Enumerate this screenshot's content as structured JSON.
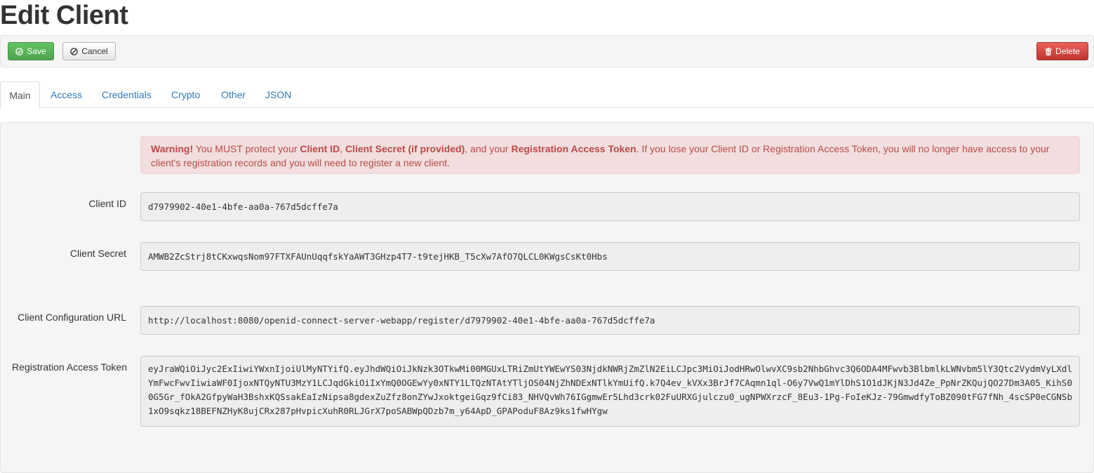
{
  "page": {
    "title": "Edit Client"
  },
  "toolbar": {
    "save_label": "Save",
    "cancel_label": "Cancel",
    "delete_label": "Delete"
  },
  "tabs": [
    {
      "label": "Main",
      "active": true
    },
    {
      "label": "Access",
      "active": false
    },
    {
      "label": "Credentials",
      "active": false
    },
    {
      "label": "Crypto",
      "active": false
    },
    {
      "label": "Other",
      "active": false
    },
    {
      "label": "JSON",
      "active": false
    }
  ],
  "warning": {
    "prefix": "Warning!",
    "t1": " You MUST protect your ",
    "b1": "Client ID",
    "t2": ", ",
    "b2": "Client Secret (if provided)",
    "t3": ", and your ",
    "b3": "Registration Access Token",
    "t4": ". If you lose your Client ID or Registration Access Token, you will no longer have access to your client's registration records and you will need to register a new client."
  },
  "fields": {
    "client_id": {
      "label": "Client ID",
      "value": "d7979902-40e1-4bfe-aa0a-767d5dcffe7a"
    },
    "client_secret": {
      "label": "Client Secret",
      "value": "AMWB2ZcStrj8tCKxwqsNom97FTXFAUnUqqfskYaAWT3GHzp4T7-t9tejHKB_T5cXw7AfO7QLCL0KWgsCsKt0Hbs"
    },
    "config_url": {
      "label": "Client Configuration URL",
      "value": "http://localhost:8080/openid-connect-server-webapp/register/d7979902-40e1-4bfe-aa0a-767d5dcffe7a"
    },
    "reg_token": {
      "label": "Registration Access Token",
      "value": "eyJraWQiOiJyc2ExIiwiYWxnIjoiUlMyNTYifQ.eyJhdWQiOiJkNzk3OTkwMi00MGUxLTRiZmUtYWEwYS03NjdkNWRjZmZlN2EiLCJpc3MiOiJodHRwOlwvXC9sb2NhbGhvc3Q6ODA4MFwvb3BlbmlkLWNvbm5lY3Qtc2VydmVyLXdlYmFwcFwvIiwiaWF0IjoxNTQyNTU3MzY1LCJqdGkiOiIxYmQ0OGEwYy0xNTY1LTQzNTAtYTljOS04NjZhNDExNTlkYmUifQ.k7Q4ev_kVXx3BrJf7CAqmn1ql-O6y7VwQ1mYlDhS1O1dJKjN3Jd4Ze_PpNrZKQujQO27Dm3A05_KihS00G5Gr_fOkA2GfpyWaH3BshxKQSsakEaIzNipsa8gdexZuZfz8onZYwJxoktgeiGqz9fCi83_NHVQvWh76IGgmwEr5Lhd3crk02FuURXGjulczu0_ugNPWXrzcF_8Eu3-1Pg-FoIeKJz-79GmwdfyToBZ090tFG7fNh_4scSP0eCGNSb1xO9sqkz18BEFNZHyK8ujCRx287pHvpicXuhR0RLJGrX7poSABWpQDzb7m_y64ApD_GPAPoduF8Az9ks1fwHYgw"
    }
  }
}
